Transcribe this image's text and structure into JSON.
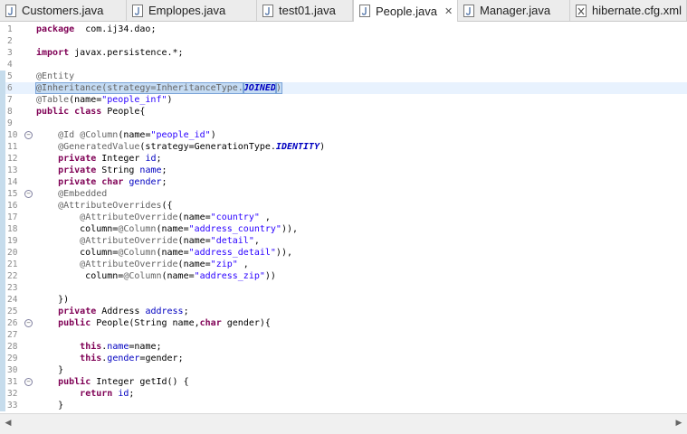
{
  "tabs": [
    {
      "label": "Customers.java",
      "icon": "java-file-icon",
      "active": false
    },
    {
      "label": "Emplopes.java",
      "icon": "java-file-icon",
      "active": false
    },
    {
      "label": "test01.java",
      "icon": "java-file-icon",
      "active": false
    },
    {
      "label": "People.java",
      "icon": "java-file-icon",
      "active": true,
      "close": "✕"
    },
    {
      "label": "Manager.java",
      "icon": "java-file-icon",
      "active": false
    },
    {
      "label": "hibernate.cfg.xml",
      "icon": "xml-file-icon",
      "active": false
    }
  ],
  "colors": {
    "keyword": "#7f0055",
    "string": "#2a00ff",
    "annotation": "#646464",
    "field": "#0000c0",
    "current_line": "#e8f2fe",
    "selection": "#c4dbf3"
  },
  "editor": {
    "current_line": 6,
    "lines": [
      {
        "n": "1",
        "fold": false,
        "marker": false,
        "tokens": [
          [
            "kw",
            "package"
          ],
          [
            "",
            "  com.ij34.dao;"
          ]
        ]
      },
      {
        "n": "2",
        "fold": false,
        "marker": false,
        "tokens": []
      },
      {
        "n": "3",
        "fold": false,
        "marker": false,
        "tokens": [
          [
            "kw",
            "import"
          ],
          [
            "",
            " javax.persistence.*;"
          ]
        ]
      },
      {
        "n": "4",
        "fold": false,
        "marker": false,
        "tokens": []
      },
      {
        "n": "5",
        "fold": false,
        "marker": true,
        "tokens": [
          [
            "ann",
            "@Entity"
          ]
        ]
      },
      {
        "n": "6",
        "fold": false,
        "marker": true,
        "tokens": [
          [
            "sel-ann",
            "@Inheritance(strategy=InheritanceType."
          ],
          [
            "sel-cst",
            "JOINED"
          ],
          [
            "sel-ann",
            ")"
          ]
        ]
      },
      {
        "n": "7",
        "fold": false,
        "marker": true,
        "tokens": [
          [
            "ann",
            "@Table"
          ],
          [
            "",
            "(name="
          ],
          [
            "str",
            "\"people_inf\""
          ],
          [
            "",
            ")"
          ]
        ]
      },
      {
        "n": "8",
        "fold": false,
        "marker": true,
        "tokens": [
          [
            "kw",
            "public"
          ],
          [
            " ",
            " "
          ],
          [
            "kw",
            "class"
          ],
          [
            "",
            " People{"
          ]
        ]
      },
      {
        "n": "9",
        "fold": false,
        "marker": true,
        "tokens": []
      },
      {
        "n": "10",
        "fold": true,
        "marker": true,
        "tokens": [
          [
            "",
            "    "
          ],
          [
            "ann",
            "@Id"
          ],
          [
            "",
            " "
          ],
          [
            "ann",
            "@Column"
          ],
          [
            "",
            "(name="
          ],
          [
            "str",
            "\"people_id\""
          ],
          [
            "",
            ")"
          ]
        ]
      },
      {
        "n": "11",
        "fold": false,
        "marker": true,
        "tokens": [
          [
            "",
            "    "
          ],
          [
            "ann",
            "@GeneratedValue"
          ],
          [
            "",
            "(strategy=GenerationType."
          ],
          [
            "cst",
            "IDENTITY"
          ],
          [
            "",
            ")"
          ]
        ]
      },
      {
        "n": "12",
        "fold": false,
        "marker": true,
        "tokens": [
          [
            "",
            "    "
          ],
          [
            "kw",
            "private"
          ],
          [
            "",
            " Integer "
          ],
          [
            "fld",
            "id"
          ],
          [
            "",
            ";"
          ]
        ]
      },
      {
        "n": "13",
        "fold": false,
        "marker": true,
        "tokens": [
          [
            "",
            "    "
          ],
          [
            "kw",
            "private"
          ],
          [
            "",
            " String "
          ],
          [
            "fld",
            "name"
          ],
          [
            "",
            ";"
          ]
        ]
      },
      {
        "n": "14",
        "fold": false,
        "marker": true,
        "tokens": [
          [
            "",
            "    "
          ],
          [
            "kw",
            "private"
          ],
          [
            "",
            " "
          ],
          [
            "kw",
            "char"
          ],
          [
            "",
            " "
          ],
          [
            "fld",
            "gender"
          ],
          [
            "",
            ";"
          ]
        ]
      },
      {
        "n": "15",
        "fold": true,
        "marker": true,
        "tokens": [
          [
            "",
            "    "
          ],
          [
            "ann",
            "@Embedded"
          ]
        ]
      },
      {
        "n": "16",
        "fold": false,
        "marker": true,
        "tokens": [
          [
            "",
            "    "
          ],
          [
            "ann",
            "@AttributeOverrides"
          ],
          [
            "",
            "({"
          ]
        ]
      },
      {
        "n": "17",
        "fold": false,
        "marker": true,
        "tokens": [
          [
            "",
            "        "
          ],
          [
            "ann",
            "@AttributeOverride"
          ],
          [
            "",
            "(name="
          ],
          [
            "str",
            "\"country\""
          ],
          [
            "",
            " ,"
          ]
        ]
      },
      {
        "n": "18",
        "fold": false,
        "marker": true,
        "tokens": [
          [
            "",
            "        column="
          ],
          [
            "ann",
            "@Column"
          ],
          [
            "",
            "(name="
          ],
          [
            "str",
            "\"address_country\""
          ],
          [
            "",
            ")),"
          ]
        ]
      },
      {
        "n": "19",
        "fold": false,
        "marker": true,
        "tokens": [
          [
            "",
            "        "
          ],
          [
            "ann",
            "@AttributeOverride"
          ],
          [
            "",
            "(name="
          ],
          [
            "str",
            "\"detail\""
          ],
          [
            "",
            ","
          ]
        ]
      },
      {
        "n": "20",
        "fold": false,
        "marker": true,
        "tokens": [
          [
            "",
            "        column="
          ],
          [
            "ann",
            "@Column"
          ],
          [
            "",
            "(name="
          ],
          [
            "str",
            "\"address_detail\""
          ],
          [
            "",
            ")),"
          ]
        ]
      },
      {
        "n": "21",
        "fold": false,
        "marker": true,
        "tokens": [
          [
            "",
            "        "
          ],
          [
            "ann",
            "@AttributeOverride"
          ],
          [
            "",
            "(name="
          ],
          [
            "str",
            "\"zip\""
          ],
          [
            "",
            " ,"
          ]
        ]
      },
      {
        "n": "22",
        "fold": false,
        "marker": true,
        "tokens": [
          [
            "",
            "         column="
          ],
          [
            "ann",
            "@Column"
          ],
          [
            "",
            "(name="
          ],
          [
            "str",
            "\"address_zip\""
          ],
          [
            "",
            "))"
          ]
        ]
      },
      {
        "n": "23",
        "fold": false,
        "marker": true,
        "tokens": []
      },
      {
        "n": "24",
        "fold": false,
        "marker": true,
        "tokens": [
          [
            "",
            "    })"
          ]
        ]
      },
      {
        "n": "25",
        "fold": false,
        "marker": true,
        "tokens": [
          [
            "",
            "    "
          ],
          [
            "kw",
            "private"
          ],
          [
            "",
            " Address "
          ],
          [
            "fld",
            "address"
          ],
          [
            "",
            ";"
          ]
        ]
      },
      {
        "n": "26",
        "fold": true,
        "marker": true,
        "tokens": [
          [
            "",
            "    "
          ],
          [
            "kw",
            "public"
          ],
          [
            "",
            " People(String name,"
          ],
          [
            "kw",
            "char"
          ],
          [
            "",
            " gender){"
          ]
        ]
      },
      {
        "n": "27",
        "fold": false,
        "marker": true,
        "tokens": []
      },
      {
        "n": "28",
        "fold": false,
        "marker": true,
        "tokens": [
          [
            "",
            "        "
          ],
          [
            "kw",
            "this"
          ],
          [
            "",
            "."
          ],
          [
            "fld",
            "name"
          ],
          [
            "",
            "=name;"
          ]
        ]
      },
      {
        "n": "29",
        "fold": false,
        "marker": true,
        "tokens": [
          [
            "",
            "        "
          ],
          [
            "kw",
            "this"
          ],
          [
            "",
            "."
          ],
          [
            "fld",
            "gender"
          ],
          [
            "",
            "=gender;"
          ]
        ]
      },
      {
        "n": "30",
        "fold": false,
        "marker": true,
        "tokens": [
          [
            "",
            "    }"
          ]
        ]
      },
      {
        "n": "31",
        "fold": true,
        "marker": true,
        "tokens": [
          [
            "",
            "    "
          ],
          [
            "kw",
            "public"
          ],
          [
            "",
            " Integer getId() {"
          ]
        ]
      },
      {
        "n": "32",
        "fold": false,
        "marker": true,
        "tokens": [
          [
            "",
            "        "
          ],
          [
            "kw",
            "return"
          ],
          [
            "",
            " "
          ],
          [
            "fld",
            "id"
          ],
          [
            "",
            ";"
          ]
        ]
      },
      {
        "n": "33",
        "fold": false,
        "marker": true,
        "tokens": [
          [
            "",
            "    }"
          ]
        ]
      }
    ]
  }
}
